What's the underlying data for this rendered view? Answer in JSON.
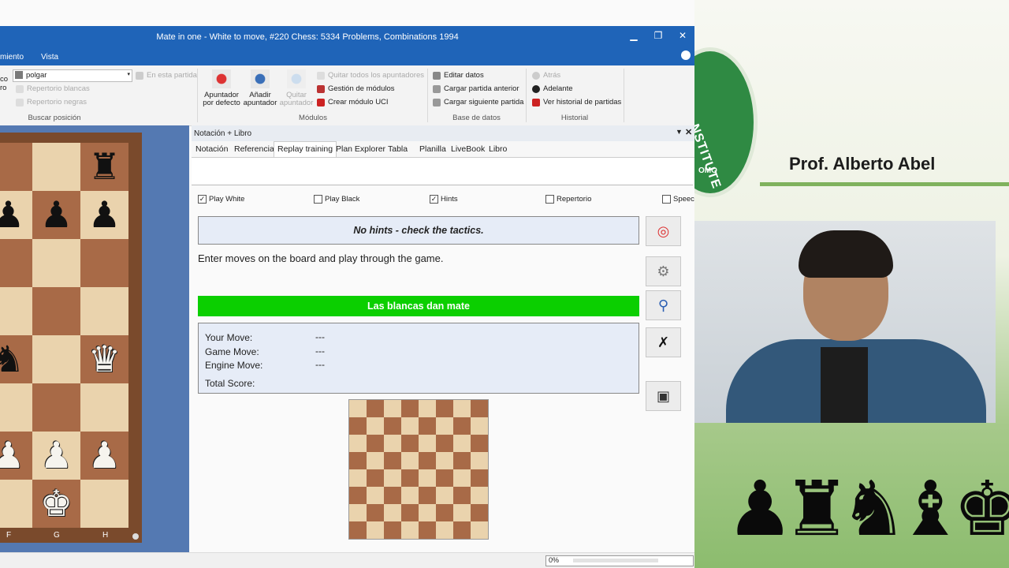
{
  "window": {
    "title": "Mate in one - White to move, #220 Chess: 5334 Problems, Combinations 1994",
    "min_glyph": "▁",
    "max_glyph": "❐",
    "close_glyph": "✕"
  },
  "menu": {
    "items": [
      "miento",
      "Vista"
    ]
  },
  "ribbon": {
    "search_value": "polgar",
    "en_esta_partida": "En esta partida",
    "repertorio_blancas": "Repertorio blancas",
    "repertorio_negras": "Repertorio negras",
    "buscar_posicion": "Buscar posición",
    "left_cut_top": "co",
    "left_cut_bottom": "ro",
    "apuntador_defecto": "Apuntador por defecto",
    "anadir_apuntador": "Añadir apuntador",
    "quitar_apuntador": "Quitar apuntador",
    "quitar_todos": "Quitar todos los apuntadores",
    "gestion_modulos": "Gestión de módulos",
    "crear_modulo": "Crear módulo UCI",
    "modulos": "Módulos",
    "editar_datos": "Editar datos",
    "cargar_anterior": "Cargar partida anterior",
    "cargar_siguiente": "Cargar siguiente partida",
    "base_datos": "Base de datos",
    "atras": "Atrás",
    "adelante": "Adelante",
    "ver_historial": "Ver historial de partidas",
    "historial": "Historial"
  },
  "board": {
    "files": [
      "F",
      "G",
      "H"
    ]
  },
  "panel": {
    "header": "Notación + Libro",
    "tabs": [
      "Notación",
      "Referencia",
      "Replay training",
      "Plan Explorer",
      "Tabla",
      "Planilla",
      "LiveBook",
      "Libro"
    ],
    "active_tab": "Replay training",
    "checkboxes": [
      {
        "label": "Play White",
        "checked": true
      },
      {
        "label": "Play Black",
        "checked": false
      },
      {
        "label": "Hints",
        "checked": true
      },
      {
        "label": "Repertorio",
        "checked": false
      },
      {
        "label": "Speech",
        "checked": false
      }
    ],
    "hint": "No hints - check the tactics.",
    "instruction": "Enter moves on the board and play through the game.",
    "result": "Las blancas dan mate",
    "score": {
      "your_move_label": "Your Move:",
      "your_move": "---",
      "game_move_label": "Game Move:",
      "game_move": "---",
      "engine_move_label": "Engine Move:",
      "engine_move": "---",
      "total_label": "Total Score:"
    }
  },
  "status": {
    "progress_text": "0%",
    "progress": 0
  },
  "video": {
    "presenter": "Prof. Alberto Abel",
    "logo_text": "NSTITUTE",
    "logo_sub": "OMO"
  },
  "colors": {
    "title_blue": "#1f64b8",
    "result_green": "#0bcf00",
    "light_square": "#ead3ad",
    "dark_square": "#a86a47"
  }
}
